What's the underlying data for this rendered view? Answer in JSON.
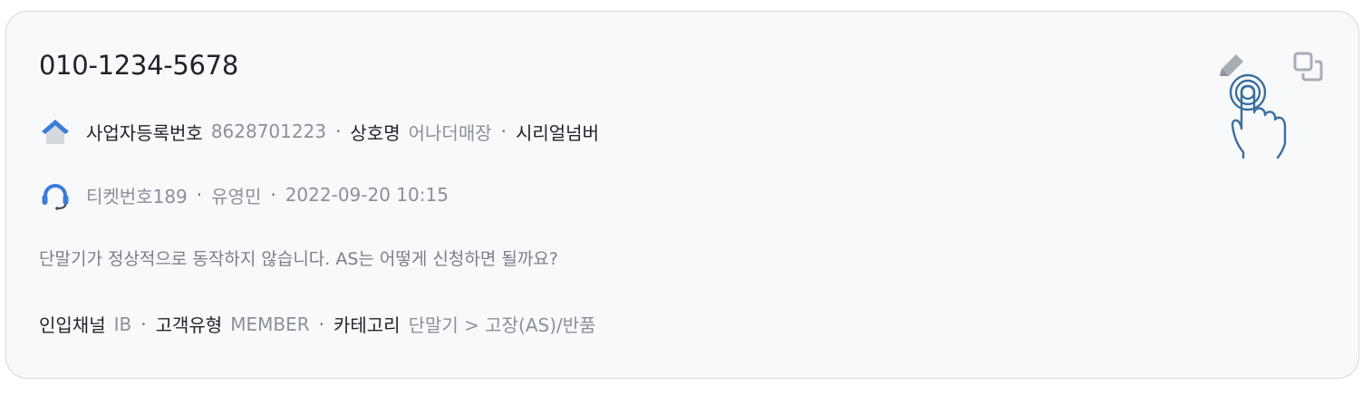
{
  "card": {
    "phone": "010-1234-5678",
    "business": {
      "reg_label": "사업자등록번호",
      "reg_value": "8628701223",
      "name_label": "상호명",
      "name_value": "어나더매장",
      "serial_label": "시리얼넘버",
      "icon": "home-icon"
    },
    "ticket": {
      "number": "티켓번호189",
      "agent": "유영민",
      "datetime": "2022-09-20 10:15",
      "icon": "headset-icon"
    },
    "message": "단말기가 정상적으로 동작하지 않습니다. AS는 어떻게 신청하면 될까요?",
    "meta": {
      "channel_label": "인입채널",
      "channel_value": "IB",
      "type_label": "고객유형",
      "type_value": "MEMBER",
      "category_label": "카테고리",
      "category_value": "단말기 > 고장(AS)/반품"
    },
    "actions": {
      "edit_icon": "pencil-icon",
      "copy_icon": "copy-icon"
    }
  },
  "colors": {
    "accent_blue": "#3b7dd8",
    "hand_stroke": "#3a6f9e",
    "icon_gray": "#a8adb5"
  }
}
